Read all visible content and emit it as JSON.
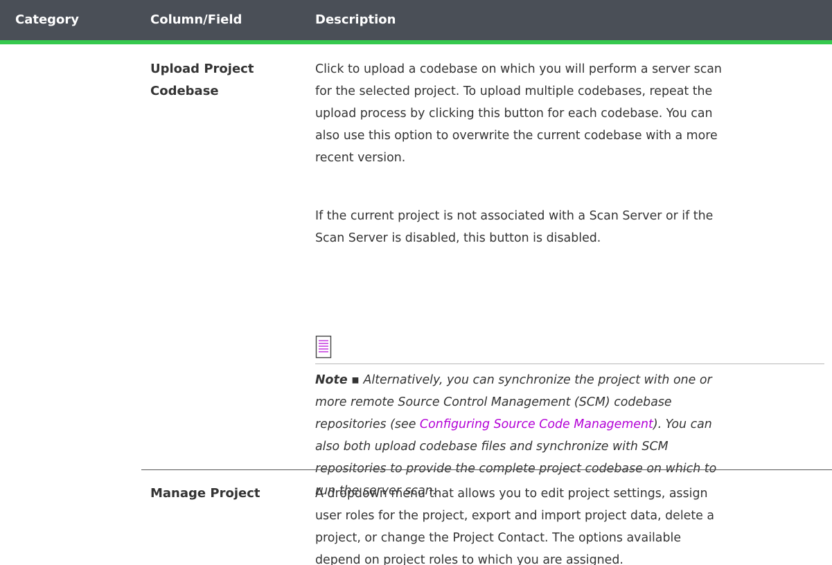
{
  "table": {
    "headers": [
      "Category",
      "Column/Field",
      "Description"
    ],
    "rows": [
      {
        "category": "",
        "field_lines": [
          "Upload Project",
          "Codebase"
        ],
        "paragraph1_lines": [
          "Click to upload a codebase on which you will perform a server scan",
          "for the selected project. To upload multiple codebases, repeat the",
          "upload process by clicking this button for each codebase. You can",
          "also use this option to overwrite the current codebase with a more",
          "recent version."
        ],
        "paragraph2_lines": [
          "If the current project is not associated with a Scan Server or if the",
          "Scan Server is disabled, this button is disabled."
        ],
        "note": {
          "icon": "note-icon",
          "label": "Note",
          "separator": " ▪ ",
          "line1": "Alternatively, you can synchronize the project with one or",
          "line2": "more remote Source Control Management (SCM) codebase",
          "line3_before": "repositories (see ",
          "link_text": "Configuring Source Code Management",
          "line3_after": "). You can",
          "line4": "also both upload codebase files and synchronize with SCM",
          "line5": "repositories to provide the complete project codebase on which to",
          "line6": "run the server scan."
        }
      },
      {
        "category": "",
        "field": "Manage Project",
        "paragraph_lines": [
          "A dropdown menu that allows you to edit project settings, assign",
          "user roles for the project, export and import project data, delete a",
          "project, or change the Project Contact. The options available",
          "depend on project roles to which you are assigned."
        ]
      }
    ]
  },
  "colors": {
    "header_bg": "#4a4f57",
    "header_accent": "#36c94e",
    "link": "#b300d6",
    "text": "#333333"
  }
}
